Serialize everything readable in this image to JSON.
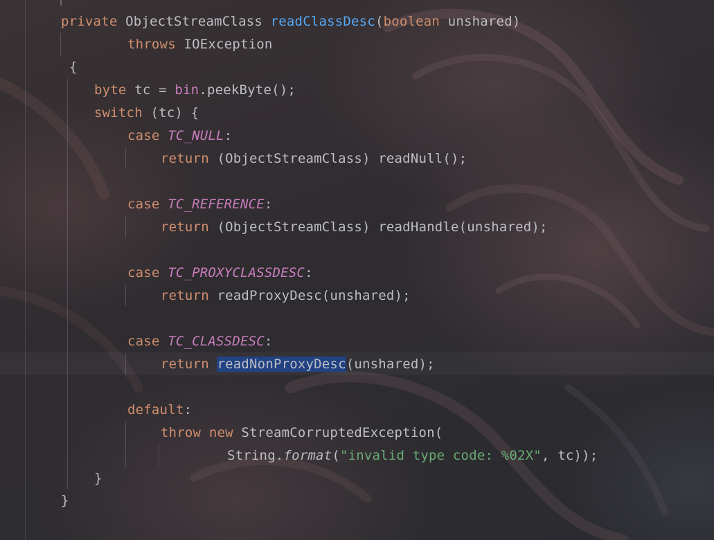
{
  "code": {
    "line1": {
      "mod": "private",
      "type": "ObjectStreamClass",
      "method": "readClassDesc",
      "lparen": "(",
      "ptype": "boolean",
      "pname": "unshared",
      "rparen": ")"
    },
    "line2": {
      "kw": "throws",
      "exc": "IOException"
    },
    "line3": {
      "text": "{"
    },
    "line4": {
      "kw": "byte",
      "mid": "tc = ",
      "field": "bin",
      "rest": ".peekByte();"
    },
    "line5": {
      "kw": "switch",
      "rest": "(tc) {"
    },
    "line6": {
      "kw": "case",
      "const": "TC_NULL",
      "colon": ":"
    },
    "line7": {
      "kw": "return",
      "rest": "(ObjectStreamClass) readNull();"
    },
    "line8": {
      "kw": "case",
      "const": "TC_REFERENCE",
      "colon": ":"
    },
    "line9": {
      "kw": "return",
      "rest": "(ObjectStreamClass) readHandle(unshared);"
    },
    "line10": {
      "kw": "case",
      "const": "TC_PROXYCLASSDESC",
      "colon": ":"
    },
    "line11": {
      "kw": "return",
      "rest": "readProxyDesc(unshared);"
    },
    "line12": {
      "kw": "case",
      "const": "TC_CLASSDESC",
      "colon": ":"
    },
    "line13": {
      "kw": "return",
      "selected": "readNonProxyDesc",
      "rest": "(unshared);"
    },
    "line14": {
      "kw": "default",
      "colon": ":"
    },
    "line15": {
      "kw1": "throw",
      "kw2": "new",
      "rest": "StreamCorruptedException("
    },
    "line16": {
      "cls": "String.",
      "method": "format",
      "lparen": "(",
      "str": "\"invalid type code: %02X\"",
      "rest": ", tc));"
    },
    "line17": {
      "text": "}"
    },
    "line18": {
      "text": "}"
    }
  },
  "colors": {
    "keyword": "#cf8e6d",
    "method_decl": "#56a8f5",
    "constant": "#c77dbb",
    "string": "#6aab73",
    "text": "#bcbec4",
    "selection": "#214283"
  }
}
